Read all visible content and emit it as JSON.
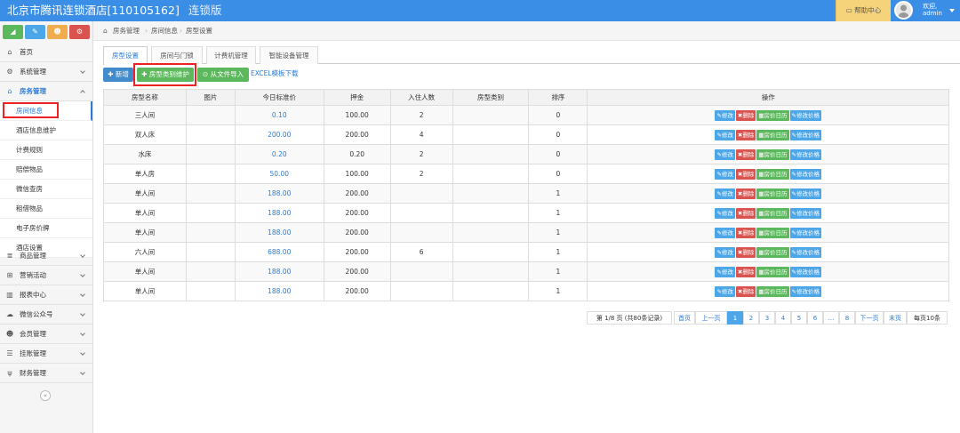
{
  "header": {
    "title": "北京市腾讯连锁酒店[110105162]",
    "edition": "连锁版",
    "help_label": "帮助中心",
    "welcome": "欢迎,",
    "username": "admin"
  },
  "sidebar": {
    "quick_buttons": [
      {
        "icon": "chart-icon",
        "color": "#5cb85c"
      },
      {
        "icon": "pencil-icon",
        "color": "#4da6e8"
      },
      {
        "icon": "users-icon",
        "color": "#f0ad4e"
      },
      {
        "icon": "cogs-icon",
        "color": "#d9534f"
      }
    ],
    "items": [
      {
        "label": "首页",
        "icon": "home-icon"
      },
      {
        "label": "系统管理",
        "icon": "gear-icon"
      },
      {
        "label": "房务管理",
        "icon": "bank-icon"
      },
      {
        "label": "商品管理",
        "icon": "database-icon"
      },
      {
        "label": "营销活动",
        "icon": "gift-icon"
      },
      {
        "label": "报表中心",
        "icon": "bar-chart-icon"
      },
      {
        "label": "微信公众号",
        "icon": "cloud-icon"
      },
      {
        "label": "会员管理",
        "icon": "users-icon"
      },
      {
        "label": "挂账管理",
        "icon": "list-icon"
      },
      {
        "label": "财务管理",
        "icon": "cutlery-icon"
      }
    ],
    "subitems": [
      "房间信息",
      "酒店信息维护",
      "计费规则",
      "赔偿物品",
      "微信查房",
      "租借物品",
      "电子房价牌",
      "酒店设置"
    ]
  },
  "breadcrumb": [
    "房务管理",
    "房间信息",
    "房型设置"
  ],
  "tabs": [
    "房型设置",
    "房间与门锁",
    "计费机管理",
    "智能设备管理"
  ],
  "toolbar": {
    "add_label": "新增",
    "category_label": "房型类别维护",
    "import_label": "从文件导入",
    "excel_label": "EXCEL模板下载"
  },
  "table": {
    "headers": [
      "房型名称",
      "图片",
      "今日标准价",
      "押金",
      "入住人数",
      "房型类别",
      "排序",
      "操作"
    ],
    "rows": [
      [
        "三人间",
        "",
        "0.10",
        "100.00",
        "2",
        "",
        "0"
      ],
      [
        "双人床",
        "",
        "200.00",
        "200.00",
        "4",
        "",
        "0"
      ],
      [
        "水床",
        "",
        "0.20",
        "0.20",
        "2",
        "",
        "0"
      ],
      [
        "单人房",
        "",
        "50.00",
        "100.00",
        "2",
        "",
        "0"
      ],
      [
        "单人间",
        "",
        "188.00",
        "200.00",
        "",
        "",
        "1"
      ],
      [
        "单人间",
        "",
        "188.00",
        "200.00",
        "",
        "",
        "1"
      ],
      [
        "单人间",
        "",
        "188.00",
        "200.00",
        "",
        "",
        "1"
      ],
      [
        "六人间",
        "",
        "688.00",
        "200.00",
        "6",
        "",
        "1"
      ],
      [
        "单人间",
        "",
        "188.00",
        "200.00",
        "",
        "",
        "1"
      ],
      [
        "单人间",
        "",
        "188.00",
        "200.00",
        "",
        "",
        "1"
      ]
    ],
    "actions": [
      "修改",
      "删除",
      "房价日历",
      "修改价格"
    ]
  },
  "pager": {
    "info": "第 1/8 页 (共80条记录)",
    "first": "首页",
    "prev": "上一页",
    "pages": [
      "1",
      "2",
      "3",
      "4",
      "5",
      "6",
      "...",
      "8"
    ],
    "next": "下一页",
    "last": "末页",
    "per_page": "每页10条"
  }
}
